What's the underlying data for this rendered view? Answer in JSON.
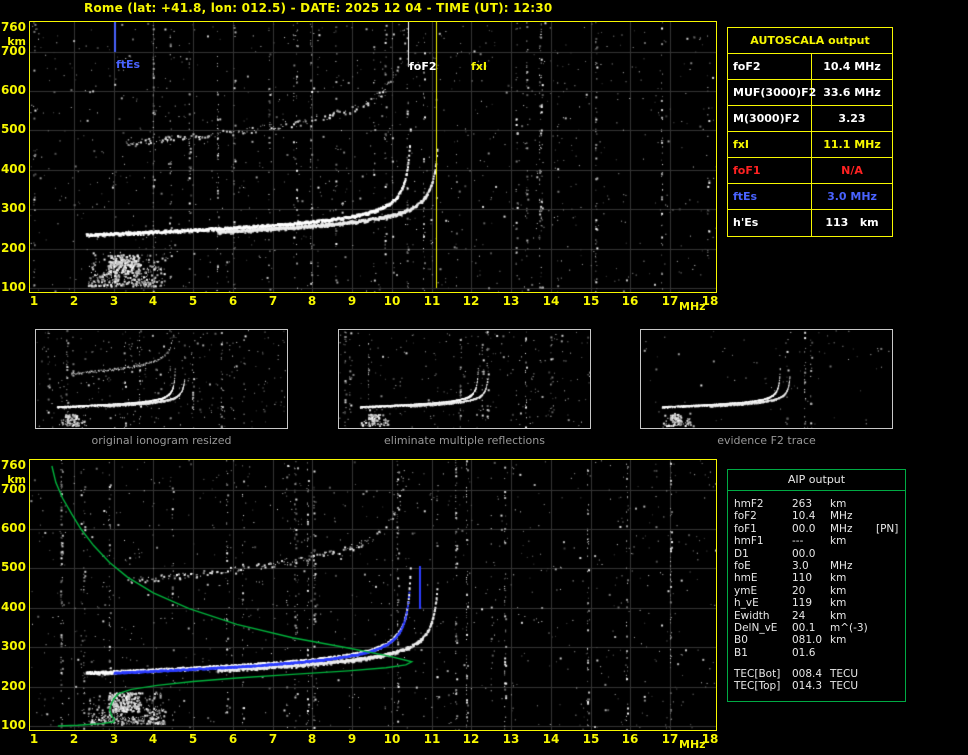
{
  "title": "Rome (lat: +41.8, lon: 012.5) - DATE: 2025 12 04 - TIME (UT): 12:30",
  "colors": {
    "accent_yellow": "#f7f700",
    "accent_green": "#00b43c",
    "accent_blue": "#4963ff",
    "accent_red": "#ff2222",
    "trace_white": "#ffffff",
    "grid_gray": "#353535",
    "caption_gray": "#989898"
  },
  "autoscala_table": {
    "header": "AUTOSCALA output",
    "rows": [
      {
        "label": "foF2",
        "value": "10.4 MHz",
        "color": "#ffffff"
      },
      {
        "label": "MUF(3000)F2",
        "value": "33.6 MHz",
        "color": "#ffffff"
      },
      {
        "label": "M(3000)F2",
        "value": "3.23",
        "color": "#ffffff"
      },
      {
        "label": "fxI",
        "value": "11.1 MHz",
        "color": "#f7f700"
      },
      {
        "label": "foF1",
        "value": "N/A",
        "color": "#ff2222"
      },
      {
        "label": "ftEs",
        "value": "3.0 MHz",
        "color": "#4963ff"
      },
      {
        "label": "h'Es",
        "value": "113   km",
        "color": "#ffffff"
      }
    ]
  },
  "thumbnails": [
    {
      "caption": "original ionogram resized",
      "render": {
        "seed": 21,
        "noise": 300,
        "streaks": 9,
        "second_hop": true
      }
    },
    {
      "caption": "eliminate multiple reflections",
      "render": {
        "seed": 22,
        "noise": 240,
        "streaks": 8,
        "second_hop": false
      }
    },
    {
      "caption": "evidence F2 trace",
      "render": {
        "seed": 23,
        "noise": 80,
        "streaks": 3,
        "second_hop": false
      }
    }
  ],
  "aip_table": {
    "header": "AIP output",
    "rows": [
      {
        "name": "hmF2",
        "value": "263",
        "unit": "km",
        "note": ""
      },
      {
        "name": "foF2",
        "value": "10.4",
        "unit": "MHz",
        "note": ""
      },
      {
        "name": "foF1",
        "value": "00.0",
        "unit": "MHz",
        "note": "[PN]"
      },
      {
        "name": "hmF1",
        "value": "---",
        "unit": "km",
        "note": ""
      },
      {
        "name": "D1",
        "value": "00.0",
        "unit": "",
        "note": ""
      },
      {
        "name": "foE",
        "value": "3.0",
        "unit": "MHz",
        "note": ""
      },
      {
        "name": "hmE",
        "value": "110",
        "unit": "km",
        "note": ""
      },
      {
        "name": "ymE",
        "value": "20",
        "unit": "km",
        "note": ""
      },
      {
        "name": "h_vE",
        "value": "119",
        "unit": "km",
        "note": ""
      },
      {
        "name": "Ewidth",
        "value": "24",
        "unit": "km",
        "note": ""
      },
      {
        "name": "DelN_vE",
        "value": "00.1",
        "unit": "m^(-3)",
        "note": ""
      },
      {
        "name": "B0",
        "value": "081.0",
        "unit": "km",
        "note": ""
      },
      {
        "name": "B1",
        "value": "01.6",
        "unit": "",
        "note": ""
      }
    ],
    "tec_rows": [
      {
        "name": "TEC[Bot]",
        "value": "008.4",
        "unit": "TECU"
      },
      {
        "name": "TEC[Top]",
        "value": "014.3",
        "unit": "TECU"
      }
    ]
  },
  "chart_data": [
    {
      "type": "scatter",
      "name": "ionogram-top",
      "xlabel": "MHz",
      "ylabel": "km",
      "xlim": [
        1,
        18
      ],
      "ylim": [
        100,
        760
      ],
      "x_ticks": [
        1,
        2,
        3,
        4,
        5,
        6,
        7,
        8,
        9,
        10,
        11,
        12,
        13,
        14,
        15,
        16,
        17,
        18
      ],
      "y_ticks": [
        760,
        700,
        600,
        500,
        400,
        300,
        200,
        100
      ],
      "grid": true,
      "markers": [
        {
          "label": "ftEs",
          "f": 3.0,
          "color": "#4963ff",
          "h_top": 760,
          "h_bot": 700,
          "w": 2
        },
        {
          "label": "foF2",
          "f": 10.4,
          "color": "#ffffff",
          "h_top": 760,
          "h_bot": 660,
          "w": 1
        },
        {
          "label": "fxI",
          "f": 11.1,
          "color": "#f7f700",
          "h_top": 760,
          "h_bot": 100,
          "w": 1
        }
      ],
      "o_trace": {
        "f0": 2.3,
        "fmax": 10.45,
        "h0": 210,
        "slope": 3.5,
        "hs": 26,
        "fa": 10.5,
        "h_clamp": 540
      },
      "x_trace": {
        "f0": 5.6,
        "fmax": 11.12,
        "h0": 214,
        "slope": 3.5,
        "hs": 26,
        "fa": 11.2,
        "h_clamp": 520
      },
      "second_hop": true,
      "es_cluster": {
        "f_range": [
          2.35,
          4.3
        ],
        "h_range": [
          106,
          200
        ]
      },
      "seed": 7,
      "noise": 950,
      "streaks": 26,
      "px": 2
    },
    {
      "type": "scatter+line",
      "name": "ionogram-bottom-with-profile",
      "xlabel": "MHz",
      "ylabel": "km",
      "xlim": [
        1,
        18
      ],
      "ylim": [
        100,
        760
      ],
      "x_ticks": [
        1,
        2,
        3,
        4,
        5,
        6,
        7,
        8,
        9,
        10,
        11,
        12,
        13,
        14,
        15,
        16,
        17,
        18
      ],
      "y_ticks": [
        760,
        700,
        600,
        500,
        400,
        300,
        200,
        100
      ],
      "grid": true,
      "markers": [
        {
          "label": "foF2-fit-marker",
          "f": 10.68,
          "color": "#2b3cff",
          "h_top": 505,
          "h_bot": 398,
          "w": 2
        }
      ],
      "o_trace": {
        "f0": 2.3,
        "fmax": 10.45,
        "h0": 210,
        "slope": 3.5,
        "hs": 26,
        "fa": 10.5,
        "h_clamp": 540
      },
      "x_trace": {
        "f0": 5.6,
        "fmax": 11.12,
        "h0": 214,
        "slope": 3.5,
        "hs": 26,
        "fa": 11.2,
        "h_clamp": 520
      },
      "second_hop": true,
      "es_cluster": {
        "f_range": [
          2.35,
          4.3
        ],
        "h_range": [
          106,
          200
        ]
      },
      "fit_trace": {
        "color": "#2b3cff",
        "f0": 3.0,
        "fmax": 10.42,
        "dh": -3
      },
      "profile": {
        "color": "#00b43c",
        "points": [
          [
            1.45,
            760
          ],
          [
            1.55,
            718
          ],
          [
            1.72,
            678
          ],
          [
            1.95,
            638
          ],
          [
            2.18,
            600
          ],
          [
            2.5,
            558
          ],
          [
            2.9,
            515
          ],
          [
            3.35,
            478
          ],
          [
            4.0,
            438
          ],
          [
            4.9,
            398
          ],
          [
            6.1,
            358
          ],
          [
            7.5,
            324
          ],
          [
            8.9,
            298
          ],
          [
            9.9,
            278
          ],
          [
            10.35,
            267
          ],
          [
            10.5,
            263
          ],
          [
            10.35,
            255
          ],
          [
            9.85,
            248
          ],
          [
            8.9,
            240
          ],
          [
            7.5,
            231
          ],
          [
            6.1,
            222
          ],
          [
            5.0,
            213
          ],
          [
            4.1,
            203
          ],
          [
            3.45,
            193
          ],
          [
            3.12,
            182
          ],
          [
            3.0,
            168
          ],
          [
            2.93,
            152
          ],
          [
            2.9,
            140
          ],
          [
            2.95,
            127
          ],
          [
            3.02,
            116
          ],
          [
            3.0,
            110
          ],
          [
            2.7,
            106
          ],
          [
            2.1,
            102
          ],
          [
            1.6,
            100
          ]
        ]
      },
      "seed": 11,
      "noise": 900,
      "streaks": 24,
      "px": 2
    }
  ]
}
